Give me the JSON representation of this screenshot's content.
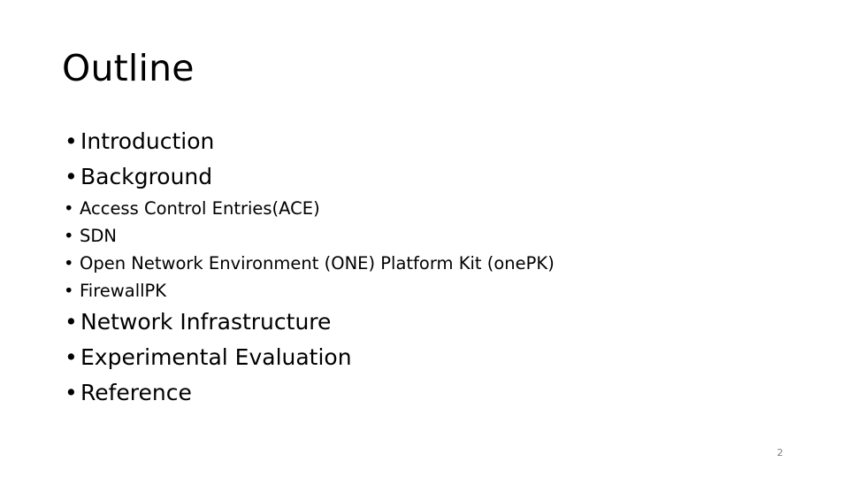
{
  "slide": {
    "title": "Outline",
    "bullet_glyph": "•",
    "page_number": "2",
    "text_color": "#000000",
    "page_number_color": "#7f7f7f",
    "background_color": "#ffffff",
    "outline_upper": [
      {
        "label": "Introduction"
      },
      {
        "label": "Background"
      }
    ],
    "sub_items": [
      {
        "label": "Access Control Entries(ACE)"
      },
      {
        "label": "SDN"
      },
      {
        "label": "Open Network Environment (ONE) Platform Kit (onePK)"
      },
      {
        "label": "FirewallPK"
      }
    ],
    "outline_lower": [
      {
        "label": "Network Infrastructure"
      },
      {
        "label": "Experimental Evaluation"
      },
      {
        "label": "Reference"
      }
    ]
  }
}
